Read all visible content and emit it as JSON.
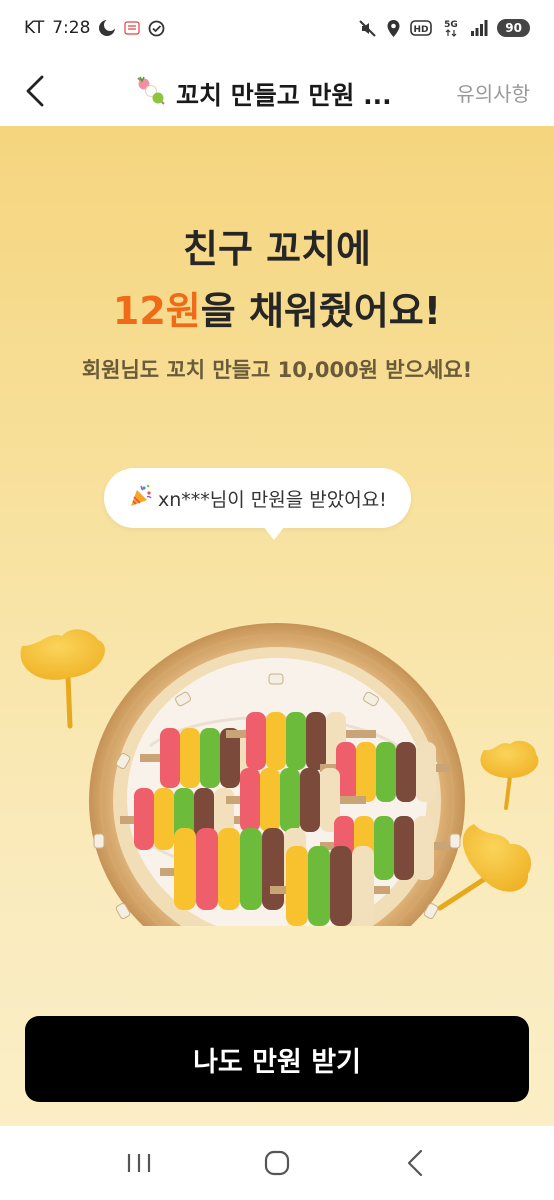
{
  "status": {
    "carrier": "KT",
    "time": "7:28",
    "battery": "90",
    "network": "5G"
  },
  "nav": {
    "title": "꼬치 만들고 만원 ...",
    "action": "유의사항"
  },
  "headline": {
    "line1": "친구 꼬치에",
    "amount": "12원",
    "line2_rest": "을 채워줬어요!"
  },
  "subline": "회원님도 꼬치 만들고 10,000원 받으세요!",
  "bubble": {
    "text": "xn***님이 만원을 받았어요!"
  },
  "cta": {
    "label": "나도 만원 받기"
  },
  "colors": {
    "accent": "#ef6b17",
    "background_top": "#f5d57e",
    "background_bottom": "#fbeec6",
    "button": "#000000"
  }
}
